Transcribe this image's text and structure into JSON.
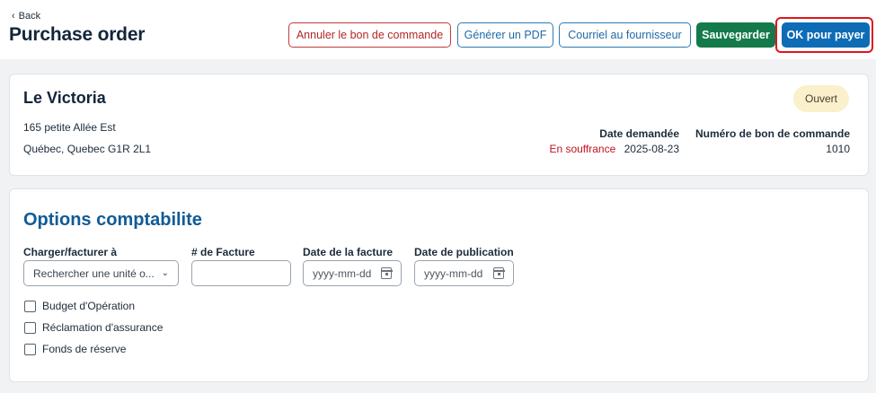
{
  "header": {
    "back_label": "Back",
    "title": "Purchase order",
    "buttons": {
      "cancel_po": "Annuler le bon de commande",
      "generate_pdf": "Générer un PDF",
      "email_supplier": "Courriel au fournisseur",
      "save": "Sauvegarder",
      "ok_to_pay": "OK pour payer"
    }
  },
  "vendor": {
    "name": "Le Victoria",
    "address_line1": "165 petite Allée Est",
    "address_line2": "Québec, Quebec G1R 2L1",
    "status": "Ouvert",
    "date_requested_label": "Date demandée",
    "date_requested_status": "En souffrance",
    "date_requested_value": "2025-08-23",
    "po_number_label": "Numéro de bon de commande",
    "po_number_value": "1010"
  },
  "accounting": {
    "title": "Options comptabilite",
    "charge_label": "Charger/facturer à",
    "charge_value": "Rechercher une unité o...",
    "invoice_label": "# de Facture",
    "invoice_value": "",
    "invoice_date_label": "Date de la facture",
    "invoice_date_placeholder": "yyyy-mm-dd",
    "publication_date_label": "Date de publication",
    "publication_date_placeholder": "yyyy-mm-dd",
    "checkboxes": [
      "Budget d'Opération",
      "Réclamation d'assurance",
      "Fonds de réserve"
    ]
  },
  "colors": {
    "accent_blue": "#0e6cb6",
    "save_green": "#147a4b",
    "cancel_red": "#b22727",
    "overdue_red": "#c1121f",
    "status_badge_bg": "#fbf0cc",
    "highlight_red": "#e0161b"
  }
}
